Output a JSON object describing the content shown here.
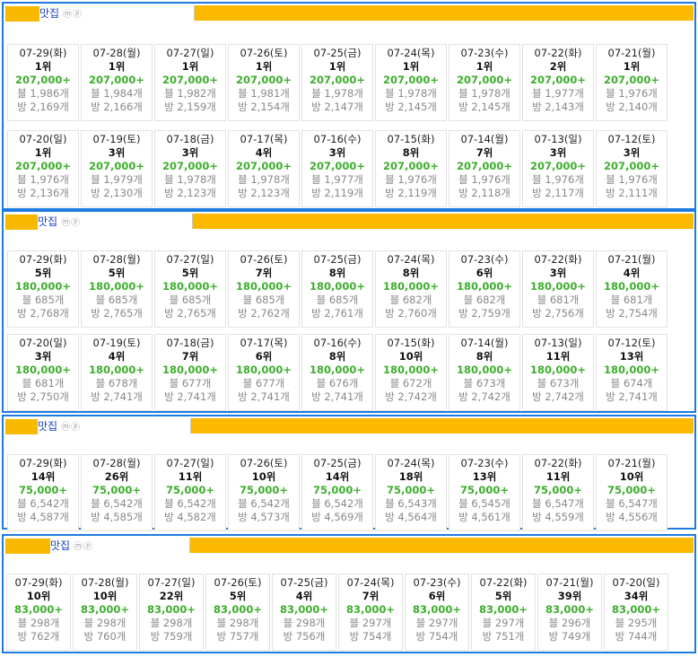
{
  "panels": [
    {
      "title": "맛집",
      "badges": "ⓜⓟ",
      "rows": [
        [
          {
            "date": "07-29(화)",
            "rank": "1위",
            "price": "207,000+",
            "blog": "블 1,986개",
            "bang": "방 2,169개"
          },
          {
            "date": "07-28(월)",
            "rank": "1위",
            "price": "207,000+",
            "blog": "블 1,984개",
            "bang": "방 2,166개"
          },
          {
            "date": "07-27(일)",
            "rank": "1위",
            "price": "207,000+",
            "blog": "블 1,982개",
            "bang": "방 2,159개"
          },
          {
            "date": "07-26(토)",
            "rank": "1위",
            "price": "207,000+",
            "blog": "블 1,981개",
            "bang": "방 2,154개"
          },
          {
            "date": "07-25(금)",
            "rank": "1위",
            "price": "207,000+",
            "blog": "블 1,978개",
            "bang": "방 2,147개"
          },
          {
            "date": "07-24(목)",
            "rank": "1위",
            "price": "207,000+",
            "blog": "블 1,978개",
            "bang": "방 2,145개"
          },
          {
            "date": "07-23(수)",
            "rank": "1위",
            "price": "207,000+",
            "blog": "블 1,978개",
            "bang": "방 2,145개"
          },
          {
            "date": "07-22(화)",
            "rank": "2위",
            "price": "207,000+",
            "blog": "블 1,977개",
            "bang": "방 2,143개"
          },
          {
            "date": "07-21(월)",
            "rank": "1위",
            "price": "207,000+",
            "blog": "블 1,976개",
            "bang": "방 2,140개"
          }
        ],
        [
          {
            "date": "07-20(일)",
            "rank": "1위",
            "price": "207,000+",
            "blog": "블 1,976개",
            "bang": "방 2,136개"
          },
          {
            "date": "07-19(토)",
            "rank": "3위",
            "price": "207,000+",
            "blog": "블 1,979개",
            "bang": "방 2,130개"
          },
          {
            "date": "07-18(금)",
            "rank": "3위",
            "price": "207,000+",
            "blog": "블 1,978개",
            "bang": "방 2,123개"
          },
          {
            "date": "07-17(목)",
            "rank": "4위",
            "price": "207,000+",
            "blog": "블 1,978개",
            "bang": "방 2,123개"
          },
          {
            "date": "07-16(수)",
            "rank": "3위",
            "price": "207,000+",
            "blog": "블 1,977개",
            "bang": "방 2,119개"
          },
          {
            "date": "07-15(화)",
            "rank": "8위",
            "price": "207,000+",
            "blog": "블 1,976개",
            "bang": "방 2,119개"
          },
          {
            "date": "07-14(월)",
            "rank": "7위",
            "price": "207,000+",
            "blog": "블 1,976개",
            "bang": "방 2,118개"
          },
          {
            "date": "07-13(일)",
            "rank": "3위",
            "price": "207,000+",
            "blog": "블 1,976개",
            "bang": "방 2,117개"
          },
          {
            "date": "07-12(토)",
            "rank": "3위",
            "price": "207,000+",
            "blog": "블 1,976개",
            "bang": "방 2,111개"
          }
        ]
      ]
    },
    {
      "title": "맛집",
      "badges": "ⓜⓟ",
      "rows": [
        [
          {
            "date": "07-29(화)",
            "rank": "5위",
            "price": "180,000+",
            "blog": "블 685개",
            "bang": "방 2,768개"
          },
          {
            "date": "07-28(월)",
            "rank": "5위",
            "price": "180,000+",
            "blog": "블 685개",
            "bang": "방 2,765개"
          },
          {
            "date": "07-27(일)",
            "rank": "5위",
            "price": "180,000+",
            "blog": "블 685개",
            "bang": "방 2,765개"
          },
          {
            "date": "07-26(토)",
            "rank": "7위",
            "price": "180,000+",
            "blog": "블 685개",
            "bang": "방 2,762개"
          },
          {
            "date": "07-25(금)",
            "rank": "8위",
            "price": "180,000+",
            "blog": "블 685개",
            "bang": "방 2,761개"
          },
          {
            "date": "07-24(목)",
            "rank": "8위",
            "price": "180,000+",
            "blog": "블 682개",
            "bang": "방 2,760개"
          },
          {
            "date": "07-23(수)",
            "rank": "6위",
            "price": "180,000+",
            "blog": "블 682개",
            "bang": "방 2,759개"
          },
          {
            "date": "07-22(화)",
            "rank": "3위",
            "price": "180,000+",
            "blog": "블 681개",
            "bang": "방 2,756개"
          },
          {
            "date": "07-21(월)",
            "rank": "4위",
            "price": "180,000+",
            "blog": "블 681개",
            "bang": "방 2,754개"
          }
        ],
        [
          {
            "date": "07-20(일)",
            "rank": "3위",
            "price": "180,000+",
            "blog": "블 681개",
            "bang": "방 2,750개"
          },
          {
            "date": "07-19(토)",
            "rank": "4위",
            "price": "180,000+",
            "blog": "블 678개",
            "bang": "방 2,741개"
          },
          {
            "date": "07-18(금)",
            "rank": "7위",
            "price": "180,000+",
            "blog": "블 677개",
            "bang": "방 2,741개"
          },
          {
            "date": "07-17(목)",
            "rank": "6위",
            "price": "180,000+",
            "blog": "블 677개",
            "bang": "방 2,741개"
          },
          {
            "date": "07-16(수)",
            "rank": "8위",
            "price": "180,000+",
            "blog": "블 676개",
            "bang": "방 2,741개"
          },
          {
            "date": "07-15(화)",
            "rank": "10위",
            "price": "180,000+",
            "blog": "블 672개",
            "bang": "방 2,742개"
          },
          {
            "date": "07-14(월)",
            "rank": "8위",
            "price": "180,000+",
            "blog": "블 673개",
            "bang": "방 2,742개"
          },
          {
            "date": "07-13(일)",
            "rank": "11위",
            "price": "180,000+",
            "blog": "블 673개",
            "bang": "방 2,742개"
          },
          {
            "date": "07-12(토)",
            "rank": "13위",
            "price": "180,000+",
            "blog": "블 674개",
            "bang": "방 2,741개"
          }
        ]
      ]
    },
    {
      "title": "맛집",
      "badges": "ⓜⓟ",
      "rows": [
        [
          {
            "date": "07-29(화)",
            "rank": "14위",
            "price": "75,000+",
            "blog": "블 6,542개",
            "bang": "방 4,587개"
          },
          {
            "date": "07-28(월)",
            "rank": "26위",
            "price": "75,000+",
            "blog": "블 6,542개",
            "bang": "방 4,585개"
          },
          {
            "date": "07-27(일)",
            "rank": "11위",
            "price": "75,000+",
            "blog": "블 6,542개",
            "bang": "방 4,582개"
          },
          {
            "date": "07-26(토)",
            "rank": "10위",
            "price": "75,000+",
            "blog": "블 6,542개",
            "bang": "방 4,573개"
          },
          {
            "date": "07-25(금)",
            "rank": "14위",
            "price": "75,000+",
            "blog": "블 6,542개",
            "bang": "방 4,569개"
          },
          {
            "date": "07-24(목)",
            "rank": "18위",
            "price": "75,000+",
            "blog": "블 6,543개",
            "bang": "방 4,564개"
          },
          {
            "date": "07-23(수)",
            "rank": "13위",
            "price": "75,000+",
            "blog": "블 6,545개",
            "bang": "방 4,561개"
          },
          {
            "date": "07-22(화)",
            "rank": "11위",
            "price": "75,000+",
            "blog": "블 6,547개",
            "bang": "방 4,559개"
          },
          {
            "date": "07-21(월)",
            "rank": "10위",
            "price": "75,000+",
            "blog": "블 6,547개",
            "bang": "방 4,556개"
          }
        ]
      ]
    },
    {
      "title": "맛집",
      "badges": "ⓜⓟ",
      "rows": [
        [
          {
            "date": "07-29(화)",
            "rank": "10위",
            "price": "83,000+",
            "blog": "블 298개",
            "bang": "방 762개"
          },
          {
            "date": "07-28(월)",
            "rank": "10위",
            "price": "83,000+",
            "blog": "블 298개",
            "bang": "방 760개"
          },
          {
            "date": "07-27(일)",
            "rank": "22위",
            "price": "83,000+",
            "blog": "블 298개",
            "bang": "방 759개"
          },
          {
            "date": "07-26(토)",
            "rank": "5위",
            "price": "83,000+",
            "blog": "블 298개",
            "bang": "방 757개"
          },
          {
            "date": "07-25(금)",
            "rank": "4위",
            "price": "83,000+",
            "blog": "블 298개",
            "bang": "방 756개"
          },
          {
            "date": "07-24(목)",
            "rank": "7위",
            "price": "83,000+",
            "blog": "블 297개",
            "bang": "방 754개"
          },
          {
            "date": "07-23(수)",
            "rank": "6위",
            "price": "83,000+",
            "blog": "블 297개",
            "bang": "방 754개"
          },
          {
            "date": "07-22(화)",
            "rank": "5위",
            "price": "83,000+",
            "blog": "블 297개",
            "bang": "방 751개"
          },
          {
            "date": "07-21(월)",
            "rank": "39위",
            "price": "83,000+",
            "blog": "블 296개",
            "bang": "방 749개"
          },
          {
            "date": "07-20(일)",
            "rank": "34위",
            "price": "83,000+",
            "blog": "블 295개",
            "bang": "방 744개"
          }
        ]
      ]
    }
  ],
  "colors": {
    "panel_border": "#1e7be0",
    "header_bar": "#fbb900",
    "price_text": "#3cae2c",
    "title_text": "#1a3fc8"
  }
}
